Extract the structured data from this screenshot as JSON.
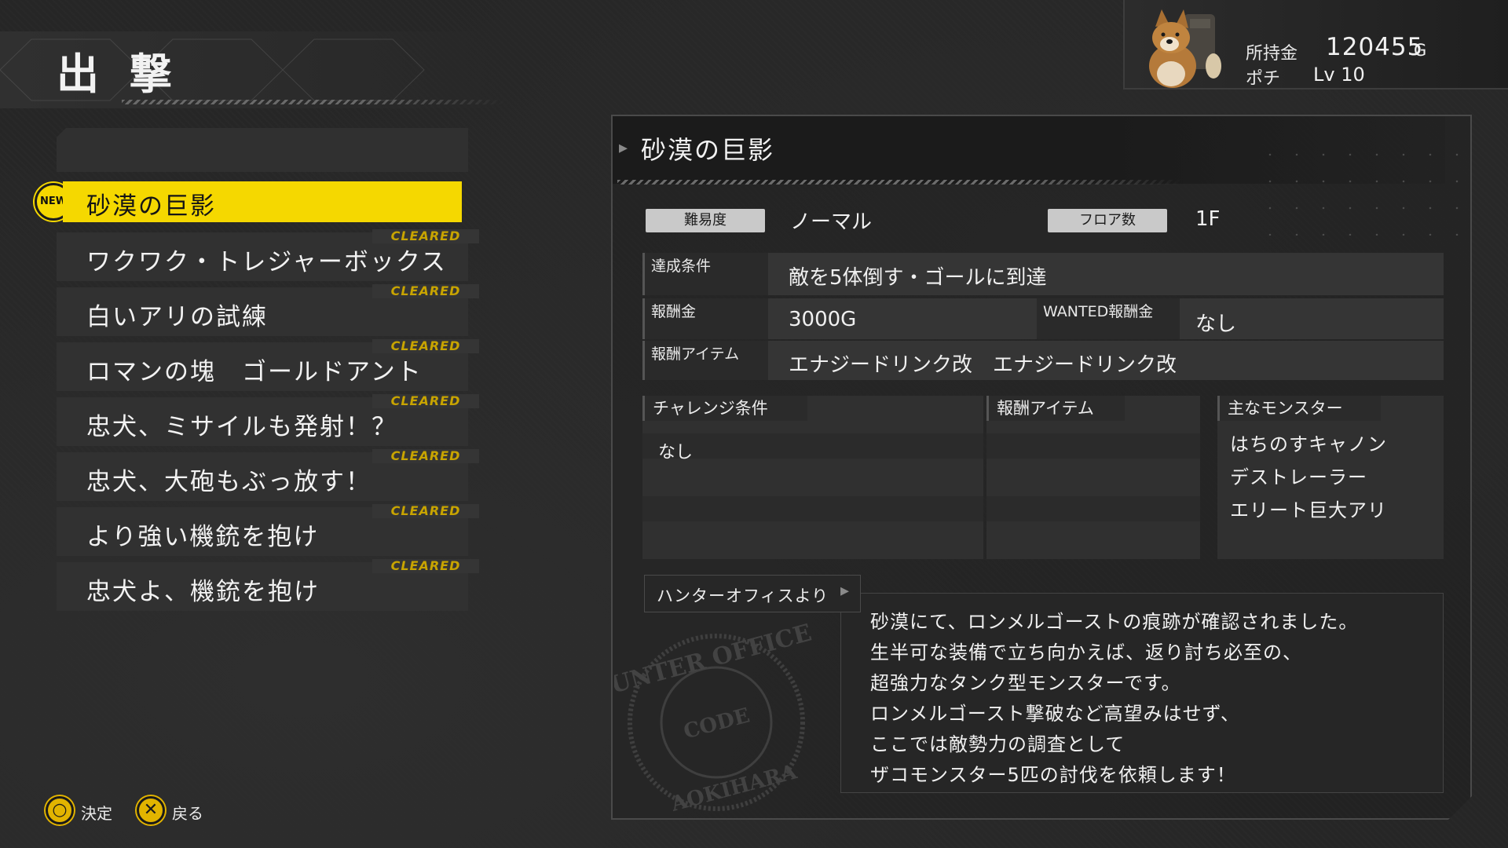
{
  "header": {
    "title": "出 撃"
  },
  "player": {
    "money_label": "所持金",
    "money_value": "120455",
    "money_unit": "G",
    "pet_name": "ポチ",
    "pet_level": "Lv 10"
  },
  "missions": {
    "new_badge": "NEW",
    "cleared_text": "CLEARED",
    "items": [
      {
        "label": "砂漠の巨影",
        "selected": true
      },
      {
        "label": "ワクワク・トレジャーボックス",
        "cleared": true
      },
      {
        "label": "白いアリの試練",
        "cleared": true
      },
      {
        "label": "ロマンの塊　ゴールドアント",
        "cleared": true
      },
      {
        "label": "忠犬、ミサイルも発射！？",
        "cleared": true
      },
      {
        "label": "忠犬、大砲もぶっ放す！",
        "cleared": true
      },
      {
        "label": "より強い機銃を抱け",
        "cleared": true
      },
      {
        "label": "忠犬よ、機銃を抱け",
        "cleared": true
      }
    ]
  },
  "detail": {
    "title": "砂漠の巨影",
    "difficulty_label": "難易度",
    "difficulty_value": "ノーマル",
    "floor_label": "フロア数",
    "floor_value": "1F",
    "condition_label": "達成条件",
    "condition_value": "敵を5体倒す・ゴールに到達",
    "reward_label": "報酬金",
    "reward_value": "3000G",
    "wanted_label": "WANTED報酬金",
    "wanted_value": "なし",
    "reward_items_label": "報酬アイテム",
    "reward_items_value": "エナジードリンク改　エナジードリンク改",
    "challenge_label": "チャレンジ条件",
    "challenge_value": "なし",
    "challenge_reward_label": "報酬アイテム",
    "monsters_label": "主なモンスター",
    "monsters": [
      "はちのすキャノン",
      "デストレーラー",
      "エリート巨大アリ"
    ],
    "office_label": "ハンターオフィスより",
    "message_lines": [
      "砂漠にて、ロンメルゴーストの痕跡が確認されました。",
      "生半可な装備で立ち向かえば、返り討ち必至の、",
      "超強力なタンク型モンスターです。",
      "ロンメルゴースト撃破など高望みはせず、",
      "ここでは敵勢力の調査として",
      "ザコモンスター5匹の討伐を依頼します！"
    ],
    "stamp_text_top": "HUNTER OFFICE",
    "stamp_text_mid": "CODE",
    "stamp_text_bottom": "AOKIHARA"
  },
  "controls": {
    "confirm_label": "決定",
    "back_label": "戻る"
  },
  "colors": {
    "accent": "#f5d800",
    "cleared": "#c8a400",
    "panel": "#313131"
  }
}
